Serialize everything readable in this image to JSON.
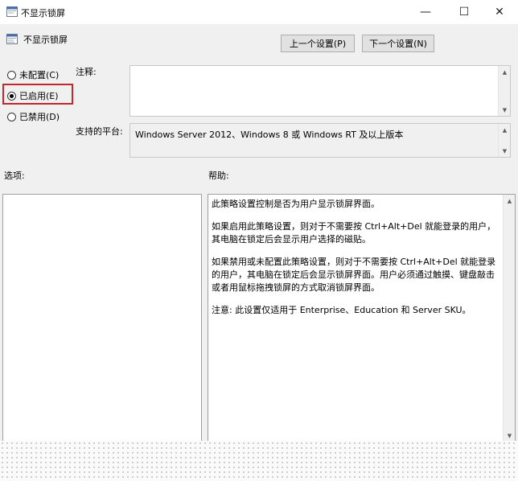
{
  "window": {
    "title": "不显示锁屏",
    "minimize_glyph": "—",
    "maximize_glyph": "☐",
    "close_glyph": "✕"
  },
  "policy": {
    "name": "不显示锁屏",
    "prev_button": "上一个设置(P)",
    "next_button": "下一个设置(N)"
  },
  "state": {
    "options": [
      {
        "label": "未配置(C)",
        "selected": false
      },
      {
        "label": "已启用(E)",
        "selected": true
      },
      {
        "label": "已禁用(D)",
        "selected": false
      }
    ]
  },
  "comment": {
    "label": "注释:",
    "value": ""
  },
  "supported": {
    "label": "支持的平台:",
    "value": "Windows Server 2012、Windows 8 或 Windows RT 及以上版本"
  },
  "options_panel": {
    "label": "选项:"
  },
  "help_panel": {
    "label": "帮助:",
    "paragraphs": [
      "此策略设置控制是否为用户显示锁屏界面。",
      "如果启用此策略设置，则对于不需要按 Ctrl+Alt+Del 就能登录的用户，其电脑在锁定后会显示用户选择的磁贴。",
      "如果禁用或未配置此策略设置，则对于不需要按 Ctrl+Alt+Del 就能登录的用户，其电脑在锁定后会显示锁屏界面。用户必须通过触摸、键盘敲击或者用鼠标拖拽锁屏的方式取消锁屏界面。",
      "注意: 此设置仅适用于 Enterprise、Education 和 Server SKU。"
    ]
  },
  "colors": {
    "highlight": "#c0282b"
  }
}
